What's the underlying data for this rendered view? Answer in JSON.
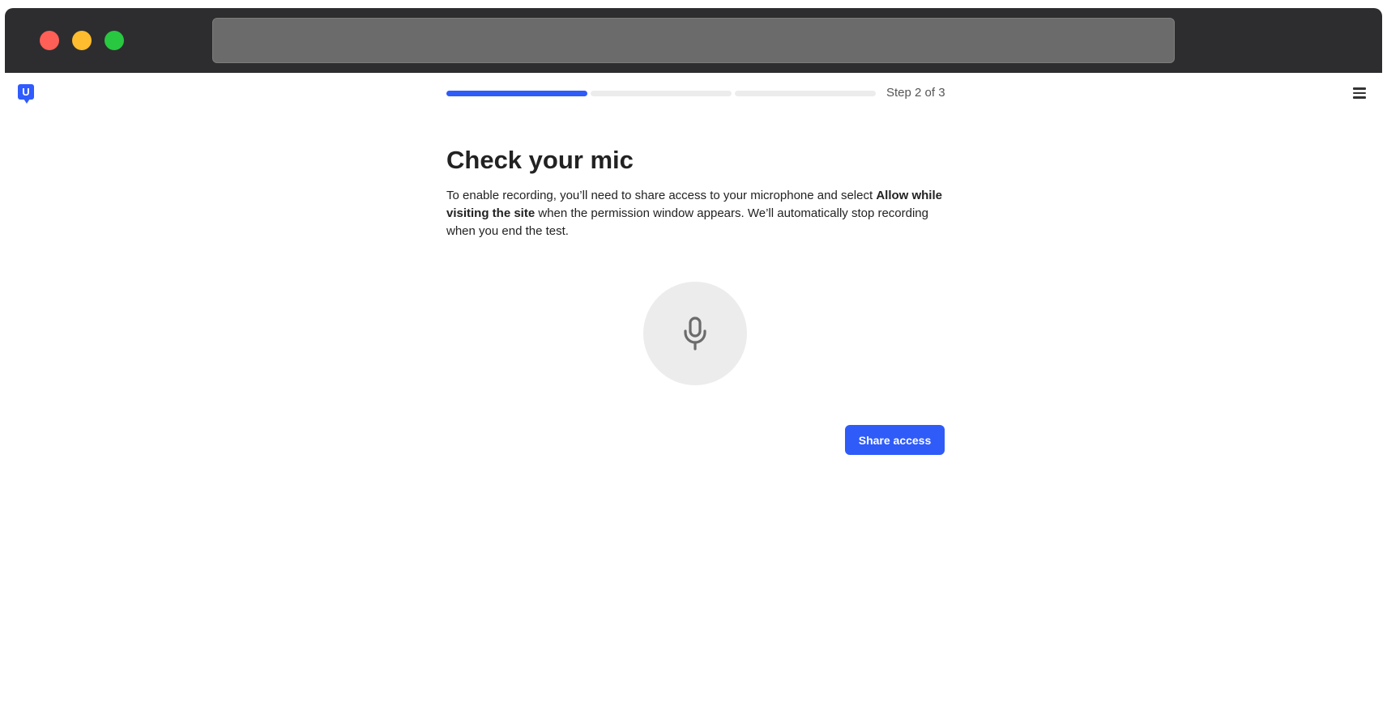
{
  "header": {
    "logo_letter": "U",
    "step_label": "Step 2 of 3",
    "progress": {
      "current_step": 2,
      "total_steps": 3
    },
    "menu_icon": "hamburger-menu-icon"
  },
  "main": {
    "title": "Check your mic",
    "description": {
      "part1": "To enable recording, you’ll need to share access to your microphone and select ",
      "bold": "Allow while visiting the site",
      "part2": " when the permission window appears. We’ll automatically stop recording when you end the test."
    },
    "mic_icon": "microphone-icon",
    "share_button_label": "Share access"
  },
  "colors": {
    "accent": "#2f5bf8",
    "progress_inactive": "#ececec",
    "mic_circle": "#ececec",
    "chrome": "#2d2d2f"
  }
}
